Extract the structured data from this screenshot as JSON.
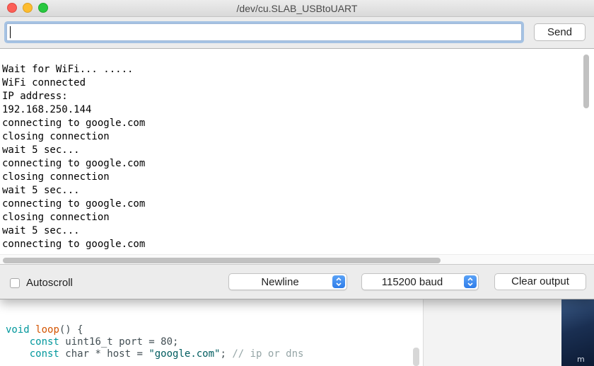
{
  "window": {
    "title": "/dev/cu.SLAB_USBtoUART"
  },
  "input": {
    "value": "",
    "send_label": "Send"
  },
  "output": {
    "lines": [
      "Wait for WiFi... .....",
      "WiFi connected",
      "IP address:",
      "192.168.250.144",
      "connecting to google.com",
      "closing connection",
      "wait 5 sec...",
      "connecting to google.com",
      "closing connection",
      "wait 5 sec...",
      "connecting to google.com",
      "closing connection",
      "wait 5 sec...",
      "connecting to google.com"
    ]
  },
  "bottom": {
    "autoscroll_label": "Autoscroll",
    "autoscroll_checked": false,
    "line_ending": "Newline",
    "baud": "115200 baud",
    "clear_label": "Clear output"
  },
  "editor": {
    "line1": {
      "kw": "void",
      "fn": "loop",
      "rest": "() {"
    },
    "line2": {
      "indent": "    ",
      "kw": "const",
      "rest": " uint16_t port = 80;"
    },
    "line3": {
      "indent": "    ",
      "kw": "const",
      "mid": " char * host = ",
      "str": "\"google.com\"",
      "sep": "; ",
      "comment": "// ip or dns"
    }
  },
  "background": {
    "thumb_glyph": "m"
  },
  "colors": {
    "close": "#fc5f57",
    "minimize": "#fdbc2e",
    "maximize": "#28c840",
    "stepper_blue": "#2f7de9",
    "focus_ring": "#6ca0dc"
  }
}
